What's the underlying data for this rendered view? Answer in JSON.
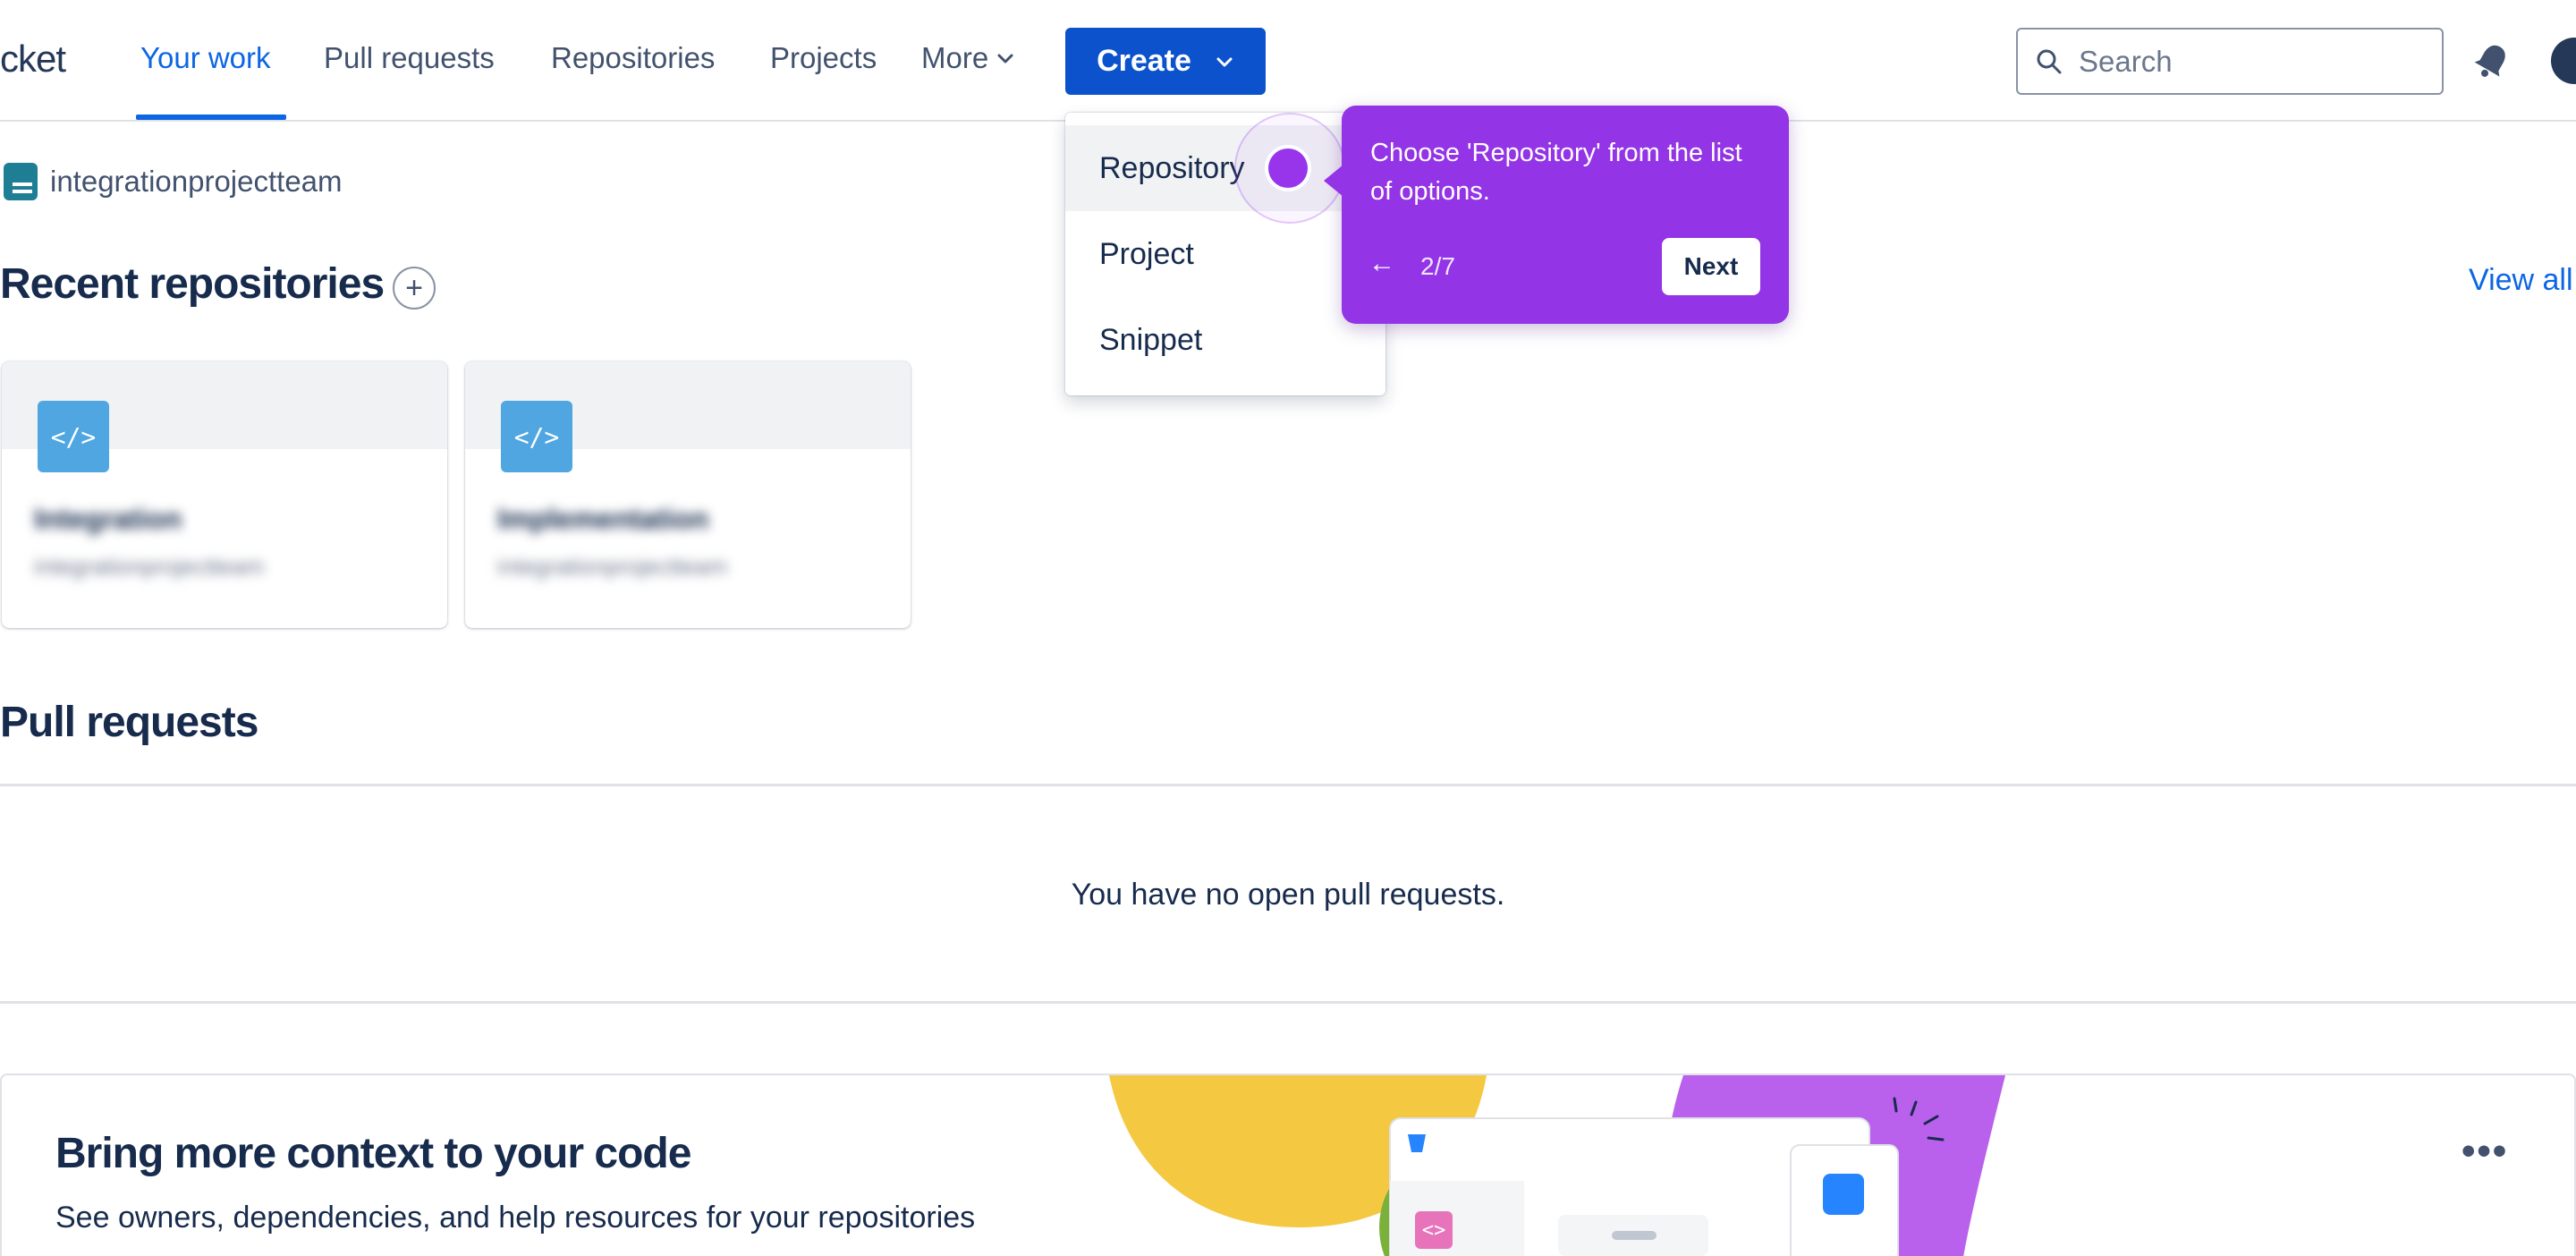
{
  "nav": {
    "logo_text": "cket",
    "items": [
      {
        "label": "Your work"
      },
      {
        "label": "Pull requests"
      },
      {
        "label": "Repositories"
      },
      {
        "label": "Projects"
      }
    ],
    "more_label": "More",
    "create_label": "Create",
    "search_placeholder": "Search"
  },
  "workspace": {
    "name": "integrationprojectteam"
  },
  "recent": {
    "title": "Recent repositories",
    "add_label": "+",
    "view_all": "View all",
    "repos": [
      {
        "icon_text": "</>",
        "name": "Integration",
        "workspace": "integrationprojectteam"
      },
      {
        "icon_text": "</>",
        "name": "Implementation",
        "workspace": "integrationprojectteam"
      }
    ]
  },
  "pull_requests": {
    "title": "Pull requests",
    "empty_text": "You have no open pull requests."
  },
  "promo": {
    "title": "Bring more context to your code",
    "description": "See owners, dependencies, and help resources for your repositories",
    "more_label": "•••"
  },
  "create_menu": {
    "items": [
      {
        "label": "Repository"
      },
      {
        "label": "Project"
      },
      {
        "label": "Snippet"
      }
    ]
  },
  "guide": {
    "text": "Choose 'Repository' from the list of options.",
    "back_label": "←",
    "step": "2/7",
    "next_label": "Next"
  },
  "colors": {
    "brand_blue": "#0c52cc",
    "link_blue": "#0c66e4",
    "guide_purple": "#9334e6",
    "text_dark": "#172b4d"
  }
}
